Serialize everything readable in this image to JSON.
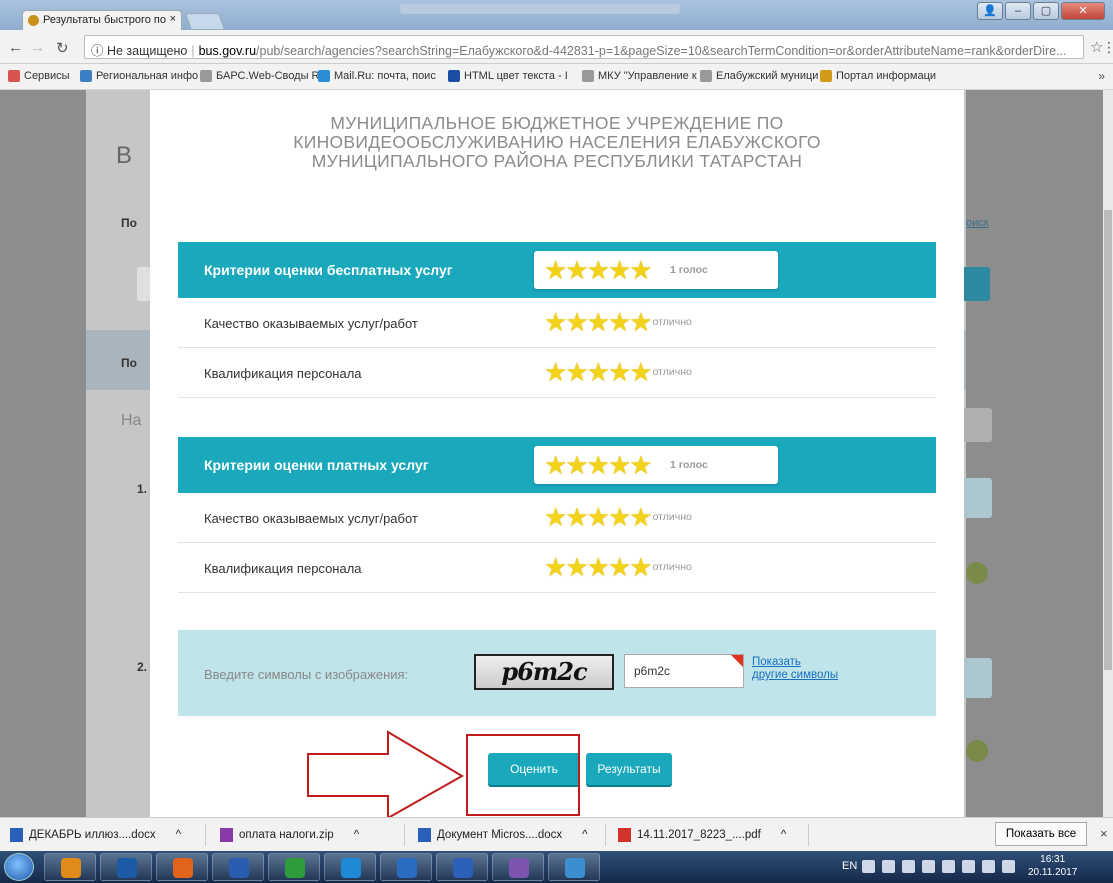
{
  "browser": {
    "tab_title": "Результаты быстрого по",
    "tab_close": "×",
    "address": {
      "security": "ⓘ Не защищено",
      "domain": "bus.gov.ru",
      "path": "/pub/search/agencies?searchString=Елабужского&d-442831-p=1&pageSize=10&searchTermCondition=or&orderAttributeName=rank&orderDire..."
    },
    "bookmarks": [
      {
        "label": "Сервисы",
        "color": "#d9534f"
      },
      {
        "label": "Региональная инфо",
        "color": "#3b7fc4"
      },
      {
        "label": "БАРС.Web-Своды Ri",
        "color": "#999999"
      },
      {
        "label": "Mail.Ru: почта, поис",
        "color": "#2a8fd8"
      },
      {
        "label": "HTML цвет текста - I",
        "color": "#1c4ea5"
      },
      {
        "label": "МКУ \"Управление к",
        "color": "#999999"
      },
      {
        "label": "Елабужский муници",
        "color": "#999999"
      },
      {
        "label": "Портал информаци",
        "color": "#d39a1a"
      }
    ]
  },
  "modal": {
    "org_lines": [
      "МУНИЦИПАЛЬНОЕ БЮДЖЕТНОЕ УЧРЕЖДЕНИЕ ПО",
      "КИНОВИДЕООБСЛУЖИВАНИЮ НАСЕЛЕНИЯ ЕЛАБУЖСКОГО",
      "МУНИЦИПАЛЬНОГО РАЙОНА РЕСПУБЛИКИ ТАТАРСТАН"
    ],
    "free": {
      "title": "Критерии оценки бесплатных услуг",
      "votes": "1 голос",
      "rating": 5,
      "rows": [
        {
          "label": "Качество оказываемых услуг/работ",
          "caption": "отлично",
          "rating": 5
        },
        {
          "label": "Квалификация персонала",
          "caption": "отлично",
          "rating": 5
        }
      ]
    },
    "paid": {
      "title": "Критерии оценки платных услуг",
      "votes": "1 голос",
      "rating": 5,
      "rows": [
        {
          "label": "Качество оказываемых услуг/работ",
          "caption": "отлично",
          "rating": 5
        },
        {
          "label": "Квалификация персонала",
          "caption": "отлично",
          "rating": 5
        }
      ]
    },
    "captcha": {
      "label": "Введите символы с изображения:",
      "image_text": "p6m2c",
      "input_value": "p6m2c",
      "link_line1": "Показать",
      "link_line2": "другие символы"
    },
    "buttons": {
      "rate": "Оценить",
      "results": "Результаты"
    }
  },
  "background": {
    "letter_b": "В",
    "po1": "По",
    "po2": "По",
    "na": "На",
    "n1": "1.",
    "n2": "2.",
    "search_link": "оиск"
  },
  "downloads": {
    "items": [
      {
        "label": "ДЕКАБРЬ иллюз....docx",
        "color": "#2b5fb8"
      },
      {
        "label": "оплата налоги.zip",
        "color": "#8a3aa8"
      },
      {
        "label": "Документ Micros....docx",
        "color": "#2b5fb8"
      },
      {
        "label": "14.11.2017_8223_....pdf",
        "color": "#d3322a"
      }
    ],
    "show_all": "Показать все",
    "close": "×"
  },
  "taskbar": {
    "lang": "EN",
    "time": "16:31",
    "date": "20.11.2017",
    "apps": [
      "#e08a1a",
      "#1c5aa8",
      "#e2641a",
      "#2a5cb0",
      "#2e9c3a",
      "#1e8ad6",
      "#2a6cc0",
      "#2b5fb8",
      "#7c55b0",
      "#3b8fd0"
    ]
  }
}
